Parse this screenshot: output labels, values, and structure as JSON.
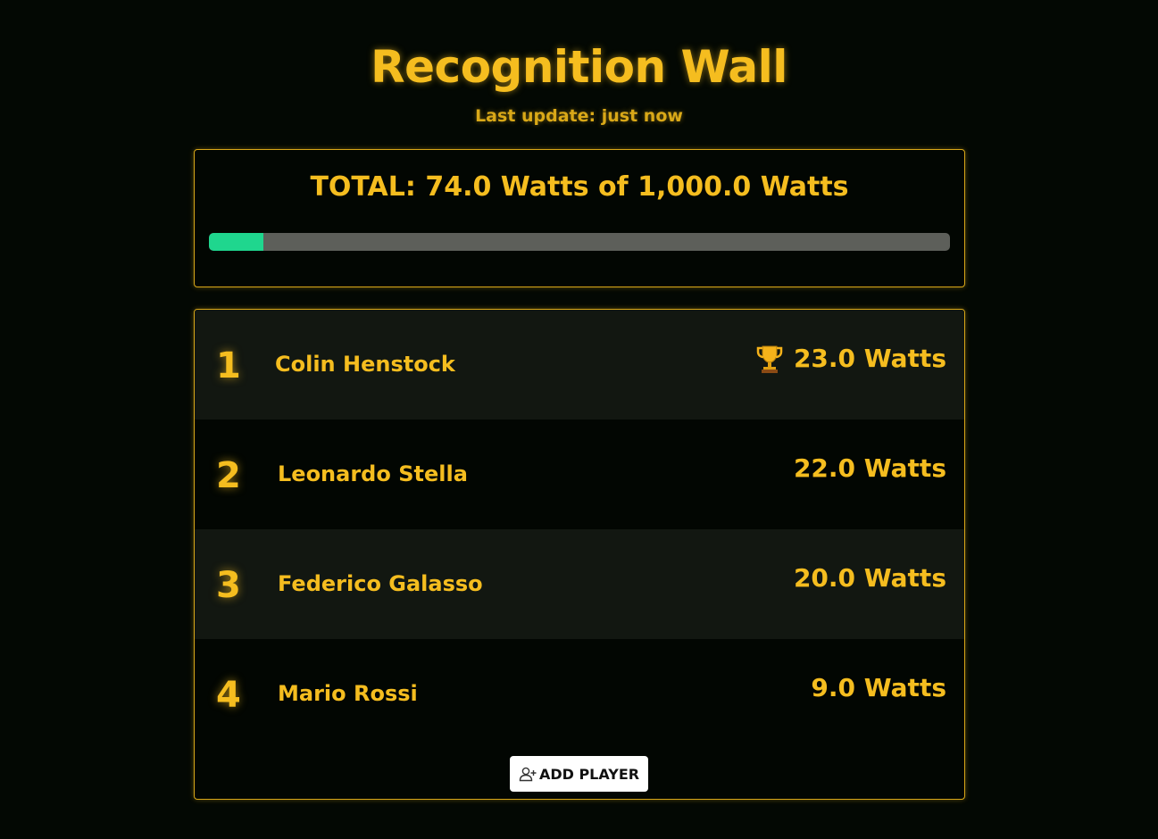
{
  "header": {
    "title": "Recognition Wall",
    "last_update": "Last update: just now"
  },
  "total": {
    "text": "TOTAL: 74.0 Watts of 1,000.0 Watts",
    "current": 74.0,
    "goal": 1000.0,
    "progress_fraction": 0.074
  },
  "leaderboard": [
    {
      "rank": "1",
      "name": "Colin Henstock",
      "score": "23.0 Watts",
      "badge": "trophy-icon"
    },
    {
      "rank": "2",
      "name": "Leonardo Stella",
      "score": "22.0 Watts"
    },
    {
      "rank": "3",
      "name": "Federico Galasso",
      "score": "20.0 Watts"
    },
    {
      "rank": "4",
      "name": "Mario Rossi",
      "score": "9.0 Watts"
    }
  ],
  "actions": {
    "add_player_label": "ADD PLAYER",
    "add_player_icon": "add-user-icon"
  },
  "colors": {
    "background": "#030803",
    "accent": "#f5bd1f",
    "progress": "#1fd68e",
    "track": "#5d5f5a"
  }
}
